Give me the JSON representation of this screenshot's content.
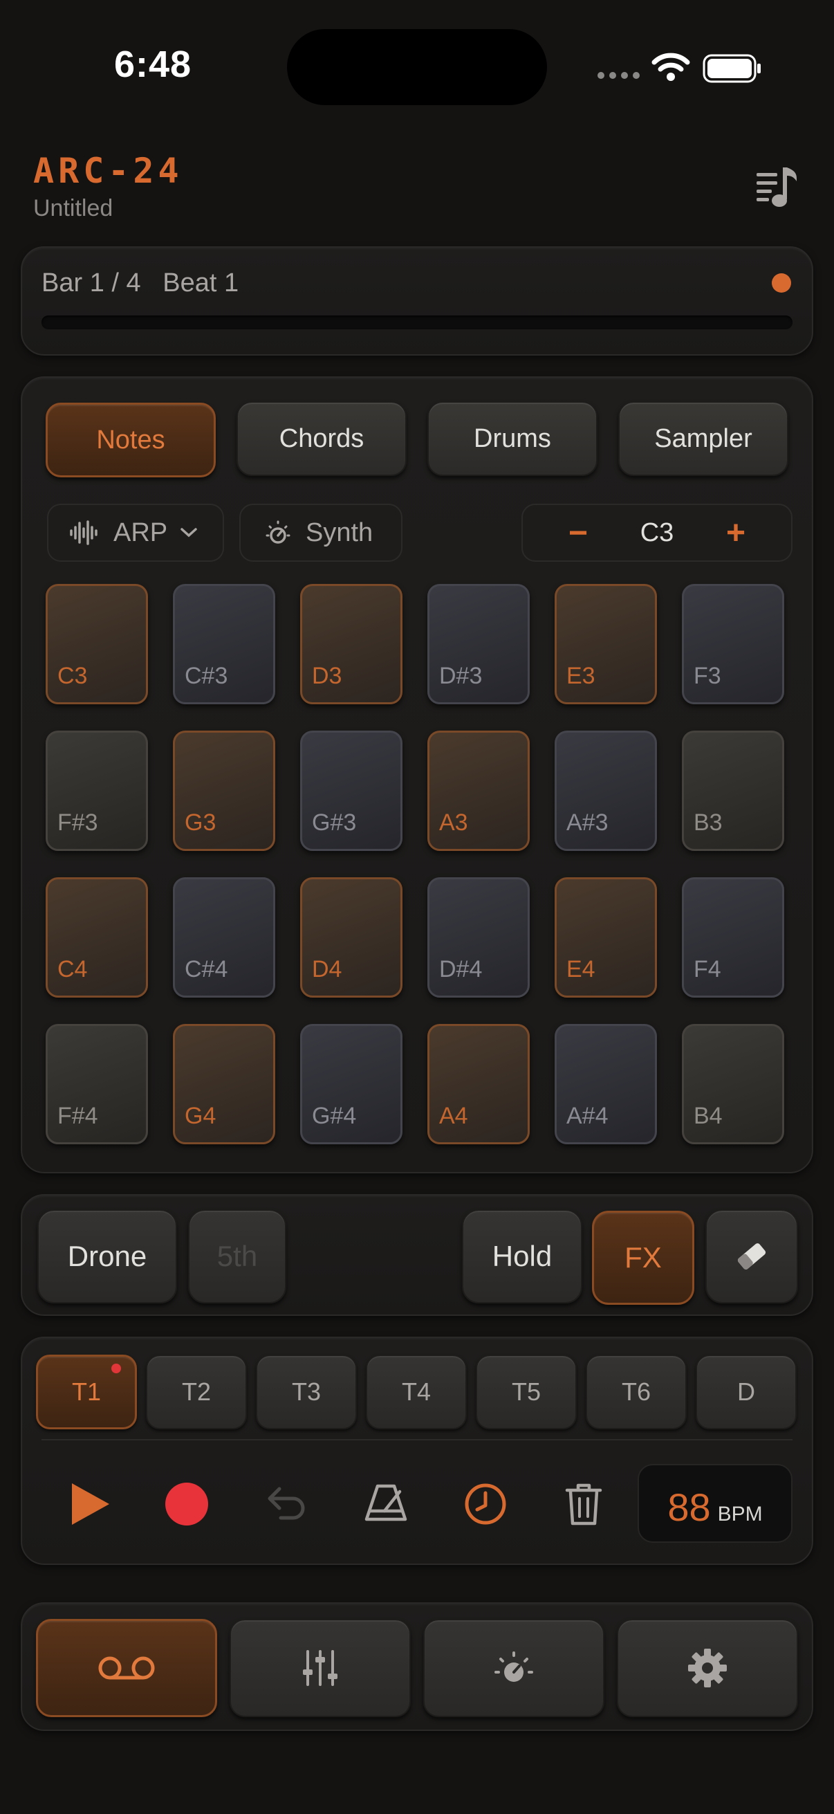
{
  "status_bar": {
    "time": "6:48"
  },
  "header": {
    "title": "ARC-24",
    "subtitle": "Untitled",
    "playlist_icon": "playlist-music-icon"
  },
  "position": {
    "bar_beat": "Bar 1 / 4   Beat 1",
    "progress": 0.0
  },
  "modes": [
    {
      "label": "Notes",
      "active": true
    },
    {
      "label": "Chords",
      "active": false
    },
    {
      "label": "Drums",
      "active": false
    },
    {
      "label": "Sampler",
      "active": false
    }
  ],
  "controls": {
    "arp_label": "ARP",
    "synth_label": "Synth",
    "octave_minus": "−",
    "octave_value": "C3",
    "octave_plus": "+"
  },
  "pads": [
    {
      "note": "C3",
      "tone": "warm"
    },
    {
      "note": "C#3",
      "tone": "cool"
    },
    {
      "note": "D3",
      "tone": "warm"
    },
    {
      "note": "D#3",
      "tone": "cool"
    },
    {
      "note": "E3",
      "tone": "warm"
    },
    {
      "note": "F3",
      "tone": "cool"
    },
    {
      "note": "F#3",
      "tone": "neutral"
    },
    {
      "note": "G3",
      "tone": "warm"
    },
    {
      "note": "G#3",
      "tone": "cool"
    },
    {
      "note": "A3",
      "tone": "warm"
    },
    {
      "note": "A#3",
      "tone": "cool"
    },
    {
      "note": "B3",
      "tone": "neutral"
    },
    {
      "note": "C4",
      "tone": "warm"
    },
    {
      "note": "C#4",
      "tone": "cool"
    },
    {
      "note": "D4",
      "tone": "warm"
    },
    {
      "note": "D#4",
      "tone": "cool"
    },
    {
      "note": "E4",
      "tone": "warm"
    },
    {
      "note": "F4",
      "tone": "cool"
    },
    {
      "note": "F#4",
      "tone": "neutral"
    },
    {
      "note": "G4",
      "tone": "warm"
    },
    {
      "note": "G#4",
      "tone": "cool"
    },
    {
      "note": "A4",
      "tone": "warm"
    },
    {
      "note": "A#4",
      "tone": "cool"
    },
    {
      "note": "B4",
      "tone": "neutral"
    }
  ],
  "performance": {
    "drone": "Drone",
    "fifth": "5th",
    "hold": "Hold",
    "fx": "FX",
    "eraser_icon": "eraser-icon"
  },
  "tracks": [
    "T1",
    "T2",
    "T3",
    "T4",
    "T5",
    "T6",
    "D"
  ],
  "transport": {
    "icons": [
      "play-icon",
      "record-icon",
      "undo-icon",
      "metronome-icon",
      "count-in-clock-icon",
      "trash-icon"
    ],
    "bpm_value": "88",
    "bpm_unit": "BPM"
  },
  "bottom_nav": [
    "tape-icon",
    "mixer-icon",
    "synth-knob-icon",
    "settings-gear-icon"
  ],
  "colors": {
    "accent": "#d96a2f",
    "record": "#e8333a",
    "background": "#141312"
  }
}
